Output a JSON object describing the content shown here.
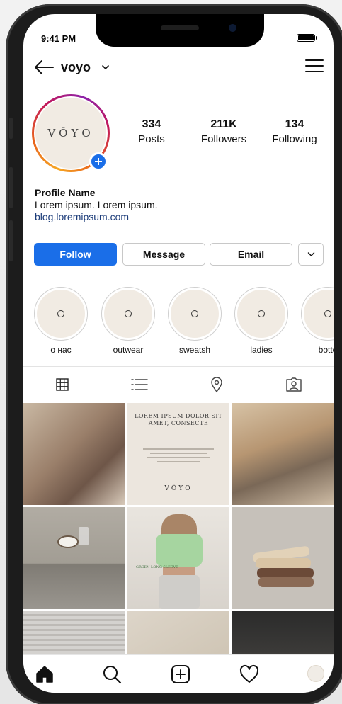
{
  "status_bar": {
    "time": "9:41 PM"
  },
  "header": {
    "username": "voyo",
    "back_icon": "arrow-left-icon",
    "switch_icon": "chevron-down-icon",
    "menu_icon": "hamburger-menu-icon"
  },
  "profile": {
    "avatar_text": "VŌYO",
    "stats": [
      {
        "value": "334",
        "label": "Posts"
      },
      {
        "value": "211K",
        "label": "Followers"
      },
      {
        "value": "134",
        "label": "Following"
      }
    ],
    "name": "Profile Name",
    "bio": "Lorem ipsum. Lorem ipsum.",
    "link": "blog.loremipsum.com"
  },
  "actions": {
    "follow": "Follow",
    "message": "Message",
    "email": "Email"
  },
  "highlights": [
    {
      "label": "о нас"
    },
    {
      "label": "outwear"
    },
    {
      "label": "sweatsh"
    },
    {
      "label": "ladies"
    },
    {
      "label": "botto"
    }
  ],
  "tabs": [
    "grid-icon",
    "list-icon",
    "location-pin-icon",
    "tagged-person-icon"
  ],
  "posts": {
    "text_card_title": "LOREM IPSUM DOLOR SIT AMET, CONSECTE",
    "text_card_logo": "VŌYO",
    "green_card_text": "GREEN LONG SLEEVE"
  },
  "bottom_nav": [
    "home-icon",
    "search-icon",
    "add-post-icon",
    "heart-icon",
    "profile-avatar"
  ],
  "colors": {
    "accent": "#1a6ee8",
    "cream": "#f1ebe3",
    "text": "#111111"
  }
}
